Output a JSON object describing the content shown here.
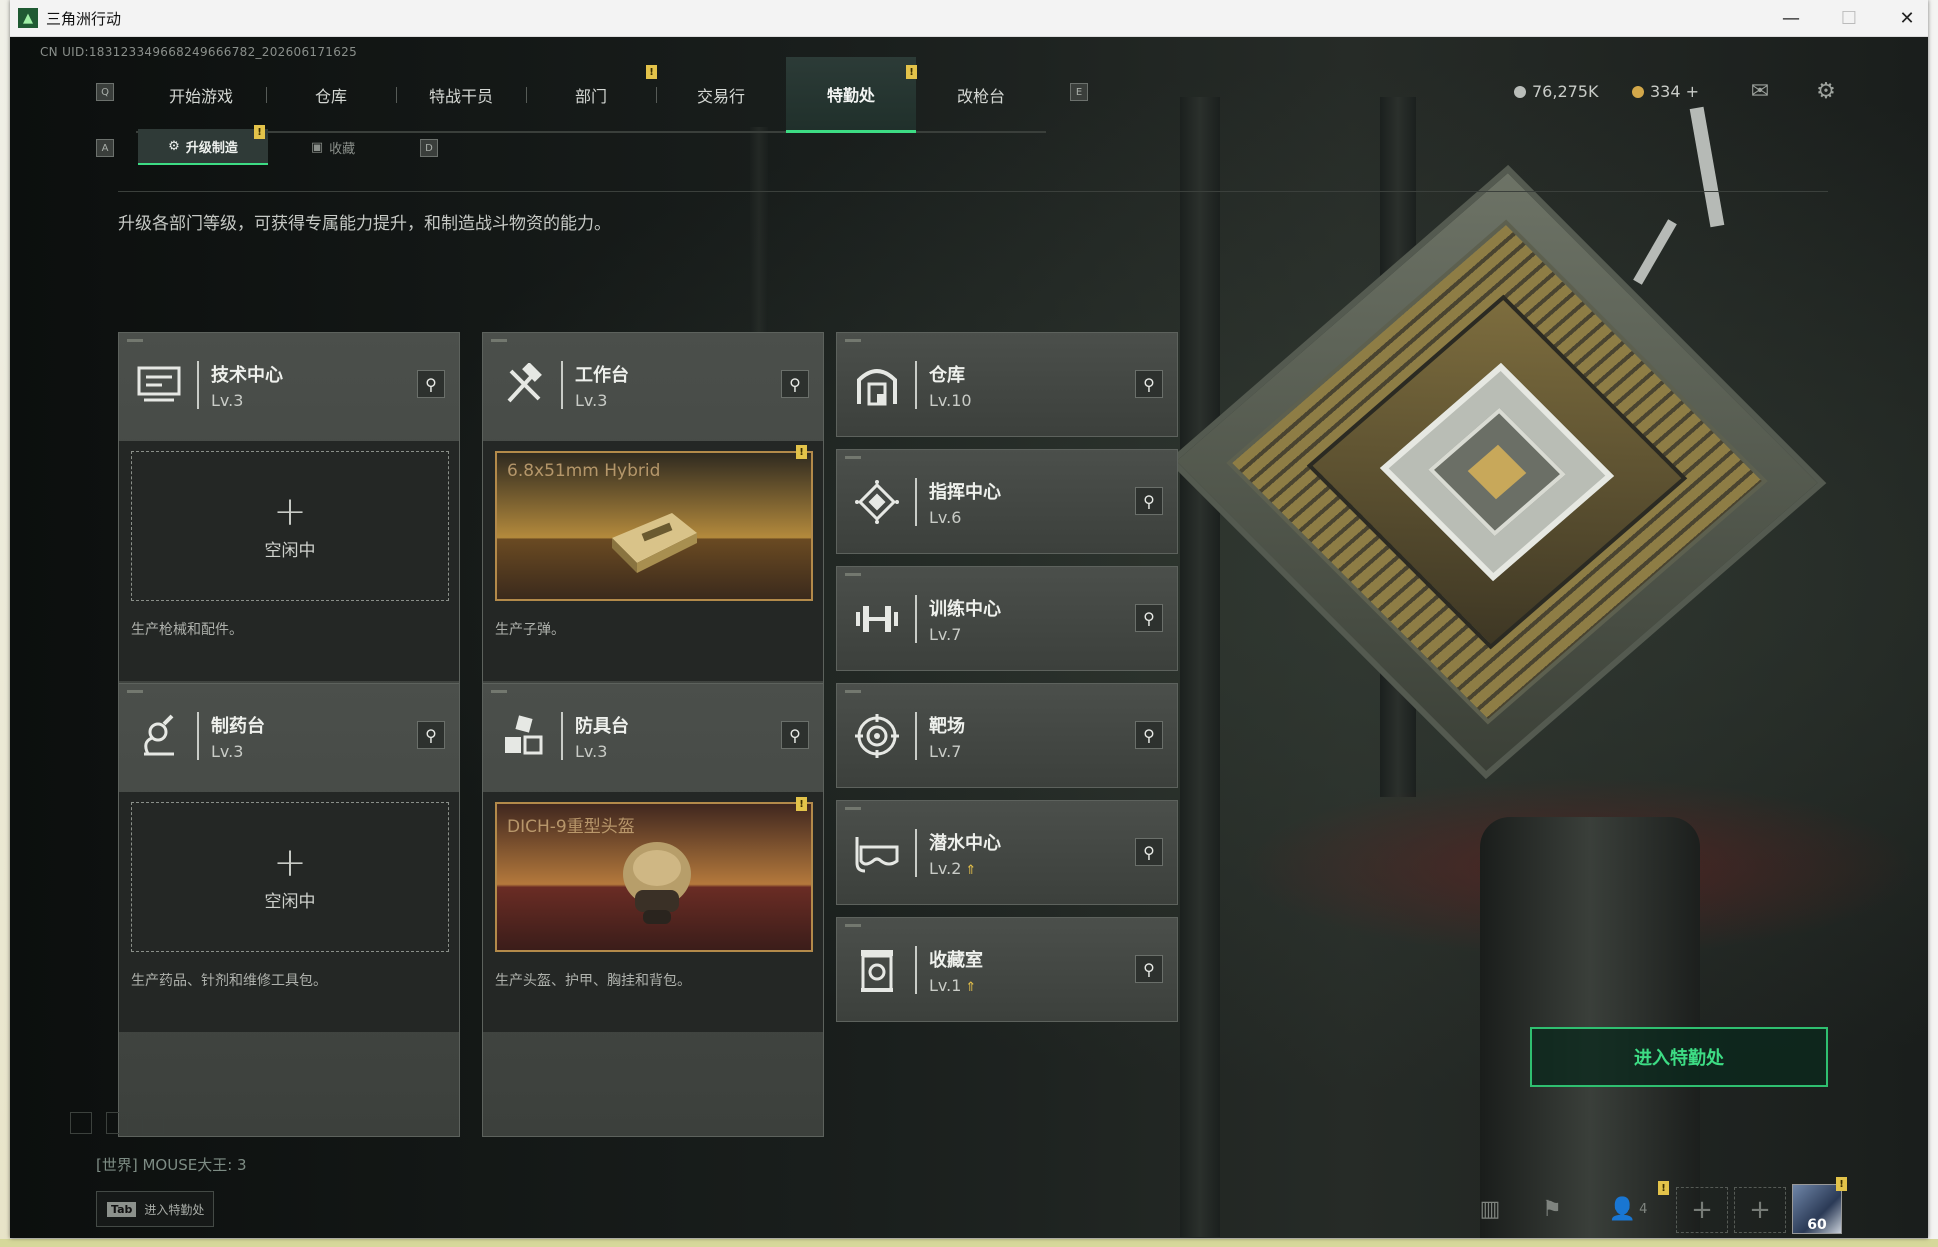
{
  "window": {
    "title": "三角洲行动"
  },
  "uid": "CN UID:183123349668249666782_202606171625",
  "nav": {
    "key_left": "Q",
    "key_right": "E",
    "items": [
      {
        "label": "开始游戏"
      },
      {
        "label": "仓库"
      },
      {
        "label": "特战干员"
      },
      {
        "label": "部门"
      },
      {
        "label": "交易行"
      },
      {
        "label": "特勤处"
      },
      {
        "label": "改枪台"
      }
    ]
  },
  "currency": {
    "coins": "76,275K",
    "premium": "334 +"
  },
  "subtabs": {
    "key_left": "A",
    "key_right": "D",
    "items": [
      {
        "label": "升级制造"
      },
      {
        "label": "收藏"
      }
    ]
  },
  "description": "升级各部门等级，可获得专属能力提升，和制造战斗物资的能力。",
  "stations": [
    {
      "name": "技术中心",
      "level": "Lv.3",
      "status": "空闲中",
      "desc": "生产枪械和配件。"
    },
    {
      "name": "工作台",
      "level": "Lv.3",
      "product": "6.8x51mm Hybrid",
      "desc": "生产子弹。"
    },
    {
      "name": "仓库",
      "level": "Lv.10"
    },
    {
      "name": "指挥中心",
      "level": "Lv.6"
    },
    {
      "name": "训练中心",
      "level": "Lv.7"
    },
    {
      "name": "制药台",
      "level": "Lv.3",
      "status": "空闲中",
      "desc": "生产药品、针剂和维修工具包。"
    },
    {
      "name": "防具台",
      "level": "Lv.3",
      "product": "DICH-9重型头盔",
      "desc": "生产头盔、护甲、胸挂和背包。"
    },
    {
      "name": "靶场",
      "level": "Lv.7"
    },
    {
      "name": "潜水中心",
      "level": "Lv.2"
    },
    {
      "name": "收藏室",
      "level": "Lv.1"
    }
  ],
  "plus_sign": "+",
  "warn_mark": "!",
  "enter_button": "进入特勤处",
  "chat": {
    "line": "[世界] MOUSE大王: 3"
  },
  "tab_hint": {
    "key": "Tab",
    "label": "进入特勤处"
  },
  "bottom": {
    "friends_count": "4",
    "avatar_level": "60"
  },
  "colors": {
    "accent": "#3ddc84",
    "warning": "#e3c34a",
    "product_frame": "#b38a4a"
  }
}
